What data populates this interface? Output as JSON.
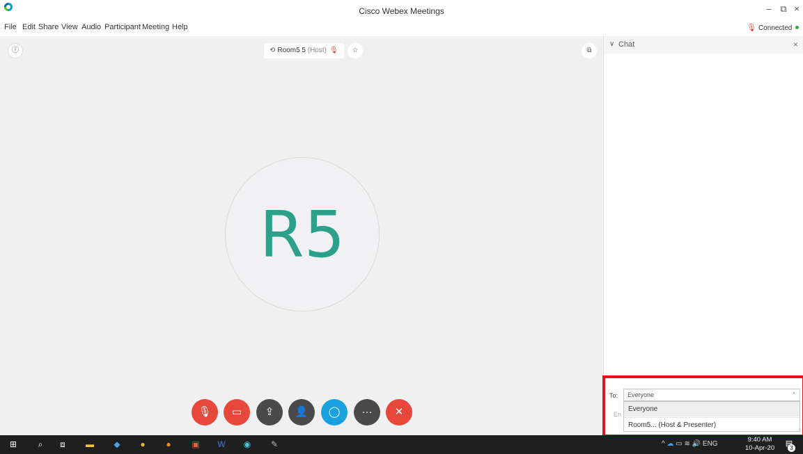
{
  "window": {
    "title": "Cisco Webex Meetings",
    "minimize_icon": "minimize-icon",
    "restore_icon": "restore-icon",
    "close_icon": "close-icon"
  },
  "menu": {
    "items": [
      "File",
      "Edit",
      "Share",
      "View",
      "Audio",
      "Participant",
      "Meeting",
      "Help"
    ]
  },
  "status": {
    "connection": "Connected",
    "connection_color": "#3aa547",
    "mute_color": "#e03b2e"
  },
  "stage": {
    "host_name": "Room5 5",
    "host_tag": "(Host)",
    "avatar_initials": "R5",
    "avatar_color": "#2ca08b"
  },
  "controls": [
    {
      "name": "mute-button",
      "icon": "muted-mic-icon",
      "color": "#e8483c"
    },
    {
      "name": "video-button",
      "icon": "video-off-icon",
      "color": "#e8483c"
    },
    {
      "name": "share-button",
      "icon": "share-icon",
      "color": "#4a4a4a"
    },
    {
      "name": "participants-button",
      "icon": "participants-icon",
      "color": "#4a4a4a"
    },
    {
      "name": "chat-button",
      "icon": "chat-icon",
      "color": "#1aa1e0"
    },
    {
      "name": "more-options-button",
      "icon": "more-icon",
      "color": "#4a4a4a"
    },
    {
      "name": "leave-button",
      "icon": "close-icon",
      "color": "#e8483c"
    }
  ],
  "chat": {
    "title": "Chat",
    "to_label": "To:",
    "selected_recipient": "Everyone",
    "input_hint": "En",
    "options": [
      "Everyone",
      "Room5... (Host & Presenter)"
    ]
  },
  "taskbar": {
    "language": "ENG",
    "time": "9:40 AM",
    "date": "10-Apr-20",
    "notifications": "3"
  }
}
